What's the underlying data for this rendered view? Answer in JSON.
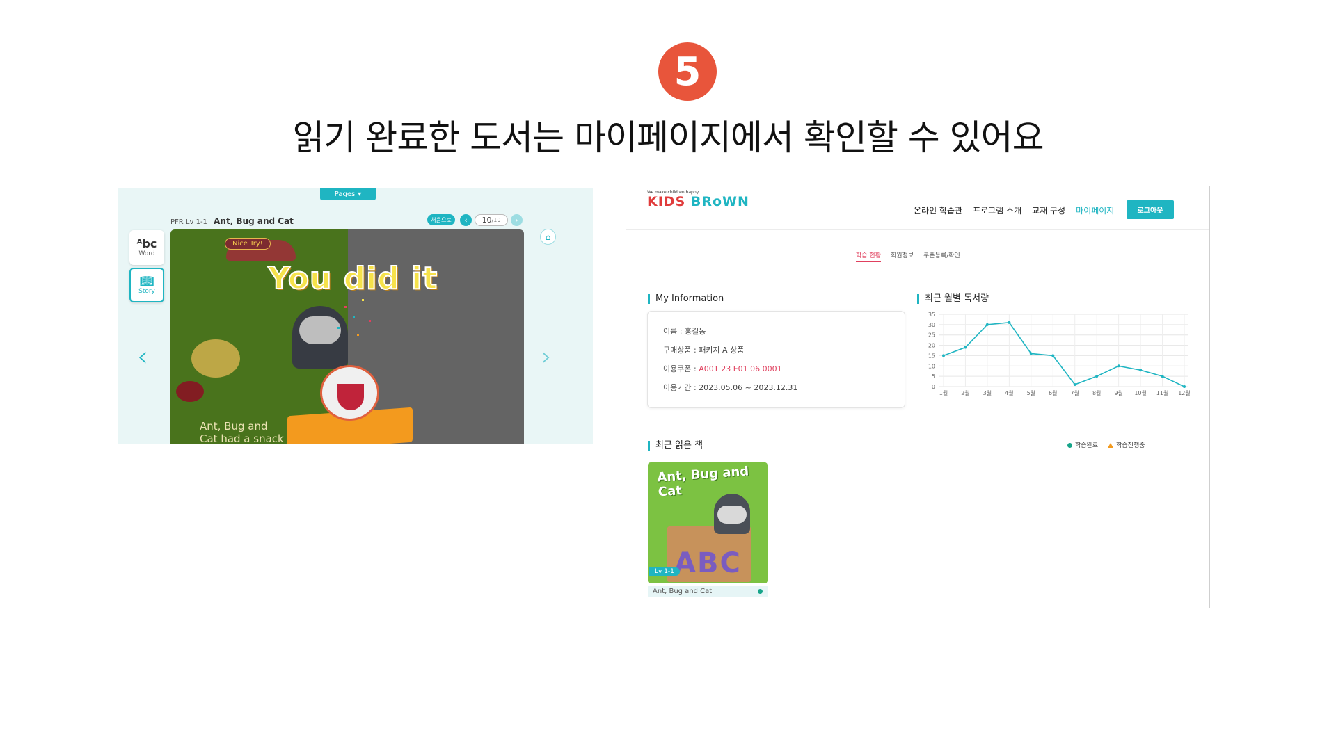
{
  "header": {
    "step_number": "5",
    "headline": "읽기 완료한 도서는 마이페이지에서 확인할 수 있어요"
  },
  "reader": {
    "pages_button": "Pages",
    "level": "PFR Lv 1-1",
    "book_title": "Ant, Bug and Cat",
    "first_page_button": "처음으로",
    "page_current": "10",
    "page_total": "/10",
    "side_word_label": "Word",
    "side_story_label": "Story",
    "badge_text": "Nice Try!",
    "celebration_text": "You did it",
    "caption_line1": "Ant, Bug and",
    "caption_line2": "Cat had a snack"
  },
  "web": {
    "logo_tagline": "We make children happy.",
    "logo_kids": "KIDS ",
    "logo_brown": "BRoWN",
    "nav": [
      "온라인 학습관",
      "프로그램 소개",
      "교재 구성",
      "마이페이지"
    ],
    "logout_button": "로그아웃",
    "subtabs": [
      "학습 현황",
      "회원정보",
      "쿠폰등록/확인"
    ],
    "my_info_title": "My Information",
    "info": {
      "name_label": "이름 : ",
      "name_value": "홍길동",
      "product_label": "구매상품 : ",
      "product_value": "패키지 A 상품",
      "coupon_label": "이용쿠폰 : ",
      "coupon_value": "A001 23 E01 06 0001",
      "period_label": "이용기간 : ",
      "period_value": "2023.05.06 ~ 2023.12.31"
    },
    "chart_title": "최근 월별 독서량",
    "recent_books_title": "최근 읽은 책",
    "legend_done": "학습완료",
    "legend_progress": "학습진행중",
    "recent_book": {
      "cover_title": "Ant, Bug and Cat",
      "cover_level": "Lv 1-1",
      "label": "Ant, Bug and Cat",
      "status": "학습완료"
    }
  },
  "colors": {
    "accent": "#1fb5c2",
    "step_circle": "#e8553b",
    "pink": "#e0405e",
    "done": "#17a58a",
    "progress": "#f39a1e"
  },
  "chart_data": {
    "type": "line",
    "title": "최근 월별 독서량",
    "categories": [
      "1월",
      "2월",
      "3월",
      "4월",
      "5월",
      "6월",
      "7월",
      "8월",
      "9월",
      "10월",
      "11월",
      "12월"
    ],
    "values": [
      15,
      19,
      30,
      31,
      16,
      15,
      1,
      5,
      10,
      8,
      5,
      0
    ],
    "ylim": [
      0,
      35
    ],
    "yticks": [
      0,
      5,
      10,
      15,
      20,
      25,
      30,
      35
    ],
    "grid": true,
    "line_color": "#1fb5c2"
  }
}
